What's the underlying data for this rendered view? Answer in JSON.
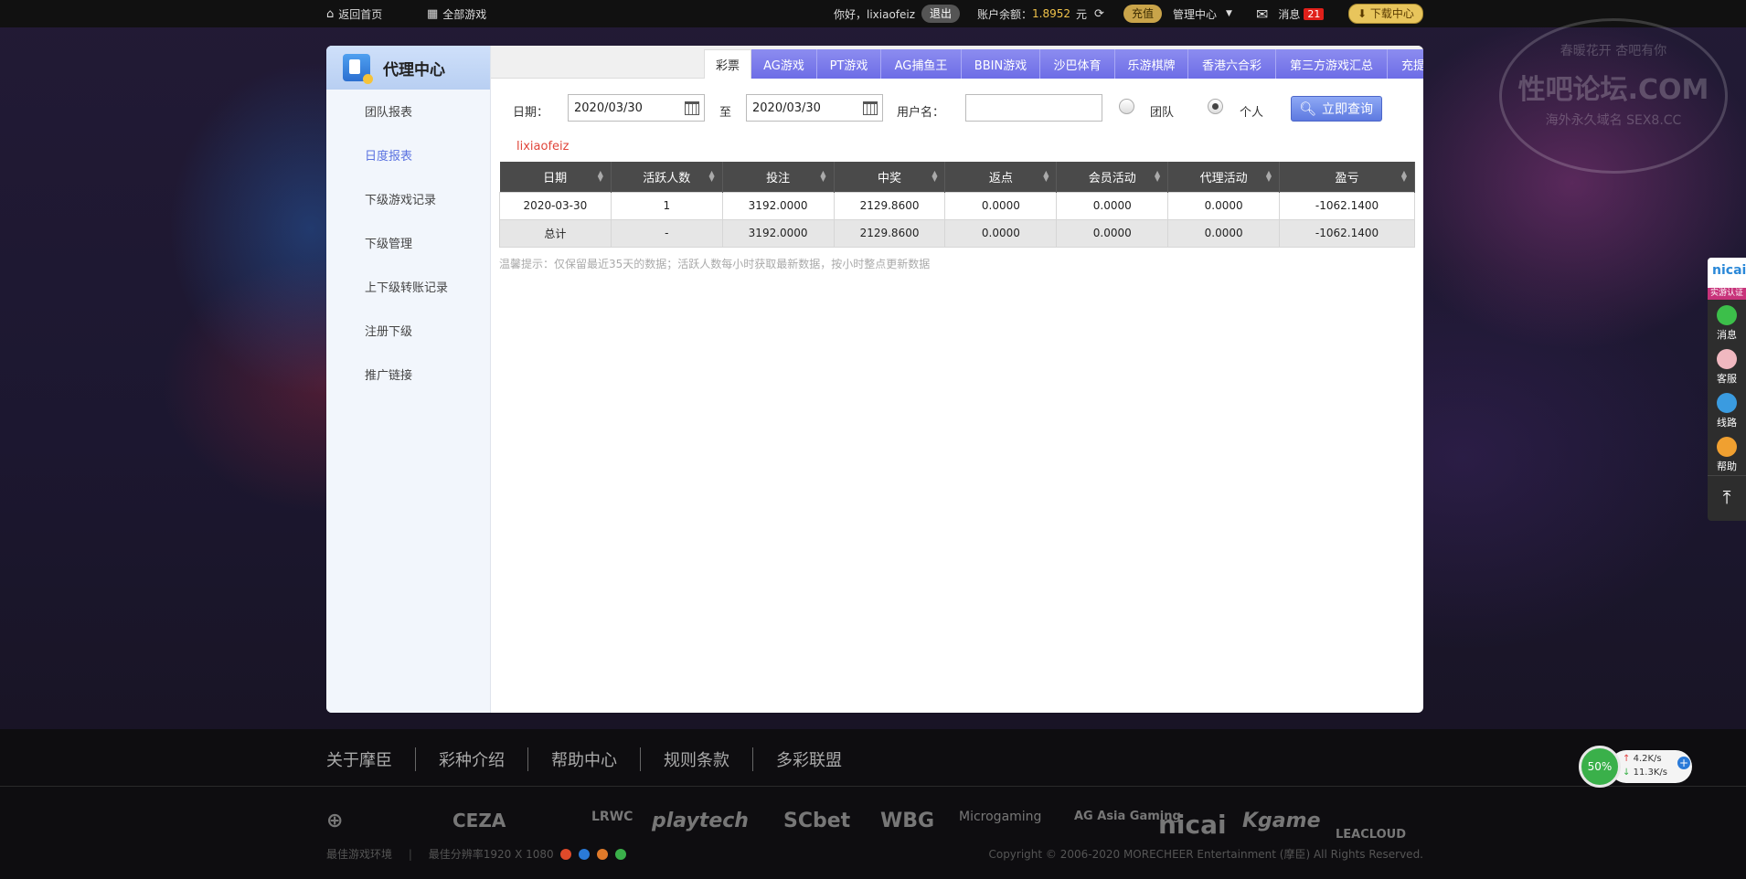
{
  "topbar": {
    "home": "返回首页",
    "all_games": "全部游戏",
    "greeting": "你好，lixiaofeiz",
    "logout": "退出",
    "balance_label": "账户余额：",
    "balance_value": "1.8952",
    "balance_unit": "元",
    "recharge": "充值",
    "manage_center": "管理中心",
    "messages": "消息",
    "message_count": "21",
    "download": "下载中心"
  },
  "sidebar": {
    "title": "代理中心",
    "items": [
      {
        "label": "团队报表",
        "active": false
      },
      {
        "label": "日度报表",
        "active": true
      },
      {
        "label": "下级游戏记录",
        "active": false
      },
      {
        "label": "下级管理",
        "active": false
      },
      {
        "label": "上下级转账记录",
        "active": false
      },
      {
        "label": "注册下级",
        "active": false
      },
      {
        "label": "推广链接",
        "active": false
      }
    ]
  },
  "tabs": [
    "彩票",
    "AG游戏",
    "PT游戏",
    "AG捕鱼王",
    "BBIN游戏",
    "沙巴体育",
    "乐游棋牌",
    "香港六合彩",
    "第三方游戏汇总",
    "充提数据"
  ],
  "filters": {
    "date_label": "日期：",
    "date_from": "2020/03/30",
    "to_label": "至",
    "date_to": "2020/03/30",
    "username_label": "用户名：",
    "username_value": "",
    "team_label": "团队",
    "personal_label": "个人",
    "selected": "个人",
    "query_button": "立即查询"
  },
  "report": {
    "username": "lixiaofeiz",
    "columns": [
      "日期",
      "活跃人数",
      "投注",
      "中奖",
      "返点",
      "会员活动",
      "代理活动",
      "盈亏"
    ],
    "rows": [
      [
        "2020-03-30",
        "1",
        "3192.0000",
        "2129.8600",
        "0.0000",
        "0.0000",
        "0.0000",
        "-1062.1400"
      ]
    ],
    "total": [
      "总计",
      "-",
      "3192.0000",
      "2129.8600",
      "0.0000",
      "0.0000",
      "0.0000",
      "-1062.1400"
    ],
    "tip": "温馨提示：仅保留最近35天的数据；活跃人数每小时获取最新数据，按小时整点更新数据"
  },
  "footer": {
    "links": [
      "关于摩臣",
      "彩种介绍",
      "帮助中心",
      "规则条款",
      "多彩联盟"
    ],
    "partner_logos": [
      "CEZA",
      "LRWC",
      "playtech",
      "SCbet",
      "WBG",
      "Microgaming",
      "AG Asia Gaming",
      "nicai",
      "Kgame",
      "LEACLOUD"
    ],
    "best_env": "最佳游戏环境",
    "best_resolution": "最佳分辨率1920 X 1080",
    "copyright": "Copyright © 2006-2020 MORECHEER Entertainment (摩臣) All Rights Reserved."
  },
  "float_bar": {
    "brand": "nicai",
    "cert": "实游认证",
    "items": [
      "消息",
      "客服",
      "线路",
      "帮助"
    ]
  },
  "speed_widget": {
    "percent": "50%",
    "up": "4.2K/s",
    "down": "11.3K/s"
  },
  "watermark": {
    "top": "春暖花开 杏吧有你",
    "main": "性吧论坛.COM",
    "bottom": "海外永久域名 SEX8.CC"
  },
  "colors": {
    "tab_bg": "#7a7aea",
    "table_header": "#4a4a4a",
    "username_red": "#e0453a",
    "active_link": "#5a72e0"
  }
}
